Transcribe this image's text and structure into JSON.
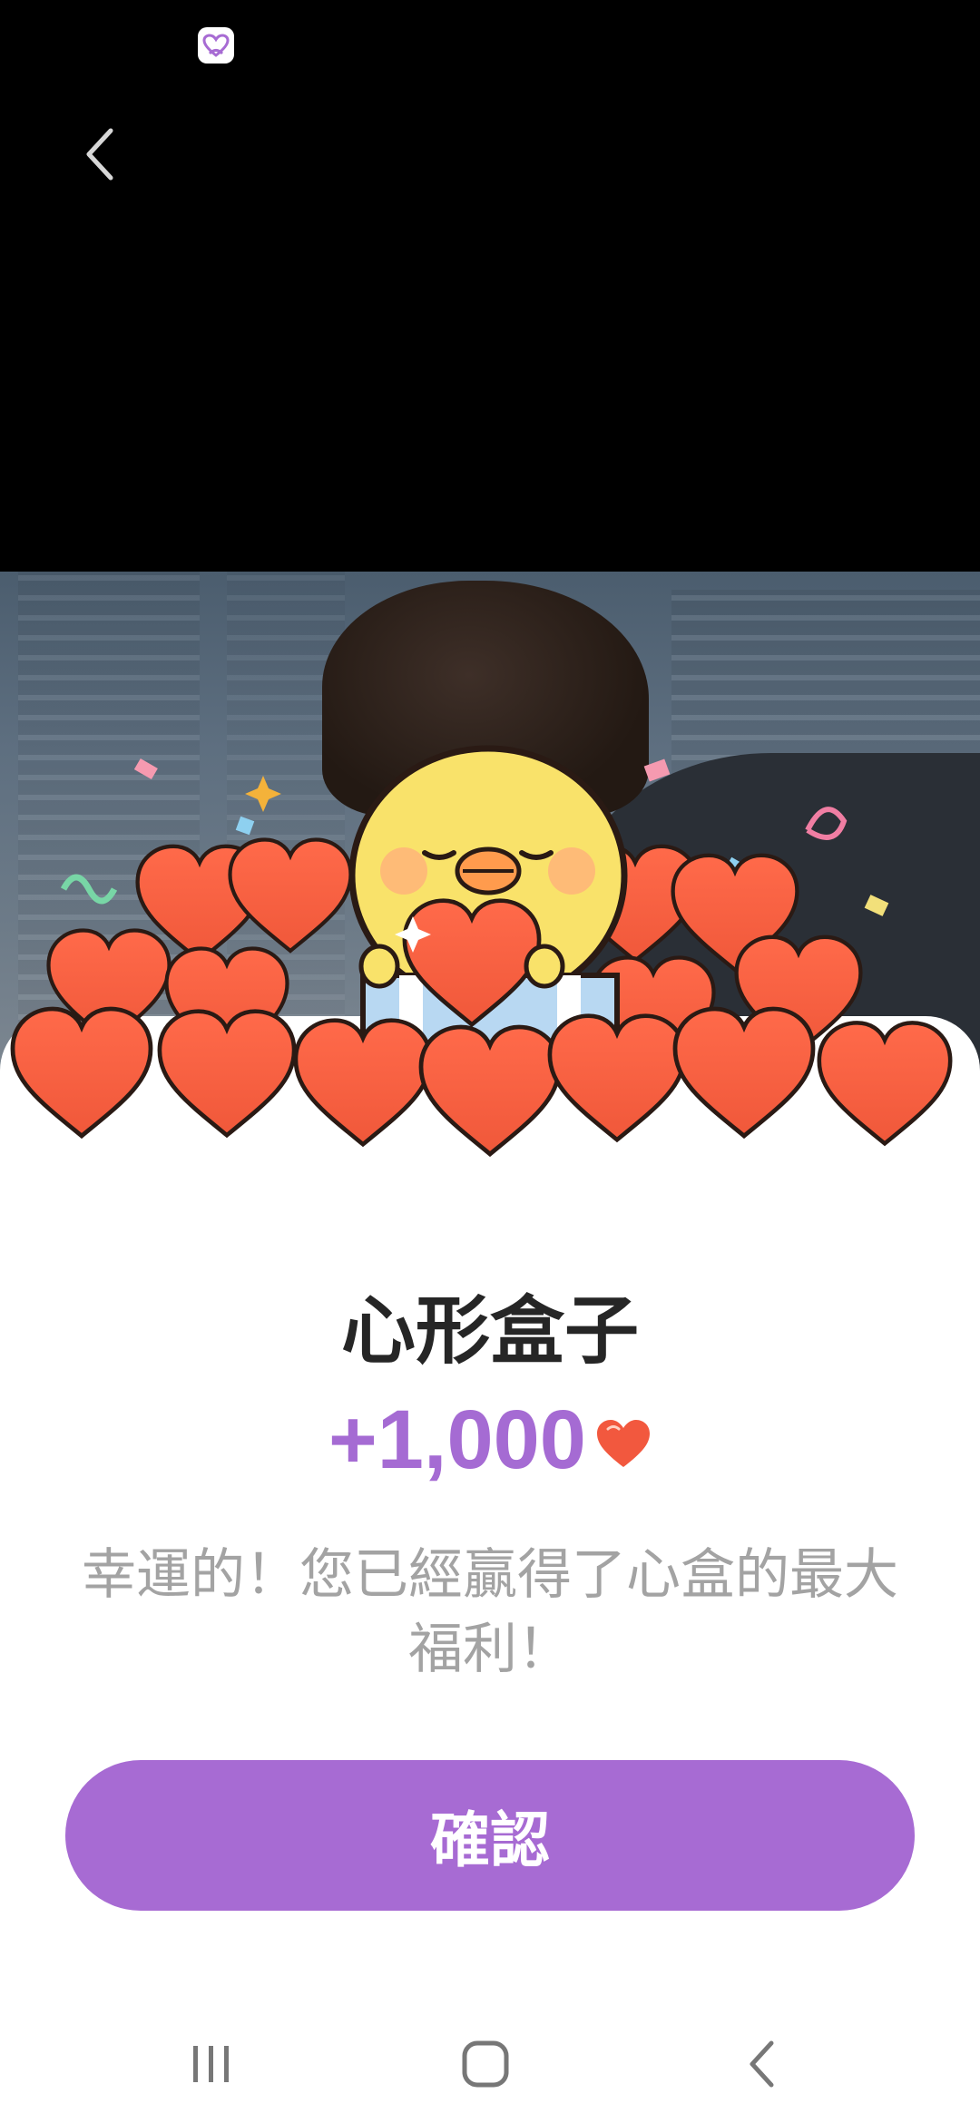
{
  "reward": {
    "title": "心形盒子",
    "amount": "+1,000",
    "message": "幸運的！您已經贏得了心盒的最大福利！",
    "confirm_label": "確認"
  },
  "colors": {
    "accent": "#a76bd3",
    "amount_text": "#a56bd3",
    "heart": "#f2583e",
    "title_text": "#262626",
    "message_text": "#a3a3a3"
  },
  "icons": {
    "status_notification": "app-heart-icon",
    "back": "back-arrow-icon",
    "nav_recents": "recents-icon",
    "nav_home": "home-icon",
    "nav_back": "nav-back-icon"
  }
}
